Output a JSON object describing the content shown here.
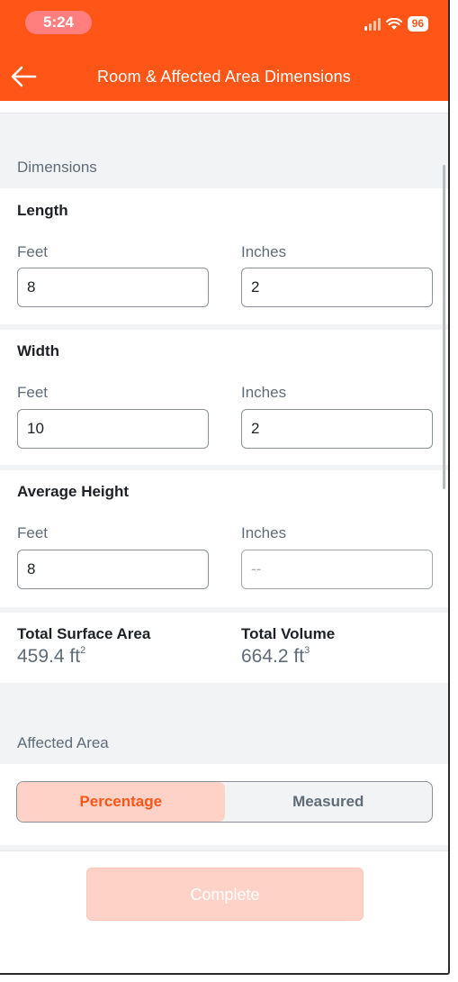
{
  "status_bar": {
    "time": "5:24",
    "battery": "96"
  },
  "header": {
    "title": "Room & Affected Area Dimensions"
  },
  "dimensions": {
    "section_label": "Dimensions",
    "length": {
      "title": "Length",
      "feet_label": "Feet",
      "feet_value": "8",
      "inches_label": "Inches",
      "inches_value": "2"
    },
    "width": {
      "title": "Width",
      "feet_label": "Feet",
      "feet_value": "10",
      "inches_label": "Inches",
      "inches_value": "2"
    },
    "height": {
      "title": "Average Height",
      "feet_label": "Feet",
      "feet_value": "8",
      "inches_label": "Inches",
      "inches_placeholder": "--"
    }
  },
  "totals": {
    "surface_label": "Total Surface Area",
    "surface_value": "459.4 ft",
    "surface_unit_sup": "2",
    "volume_label": "Total Volume",
    "volume_value": "664.2 ft",
    "volume_unit_sup": "3"
  },
  "affected_area": {
    "section_label": "Affected Area",
    "options": [
      "Percentage",
      "Measured"
    ],
    "selected": "Percentage"
  },
  "footer": {
    "complete_label": "Complete"
  },
  "colors": {
    "accent": "#ff5516",
    "accent_light": "#ffd2c8",
    "muted_text": "#5f6b78"
  }
}
